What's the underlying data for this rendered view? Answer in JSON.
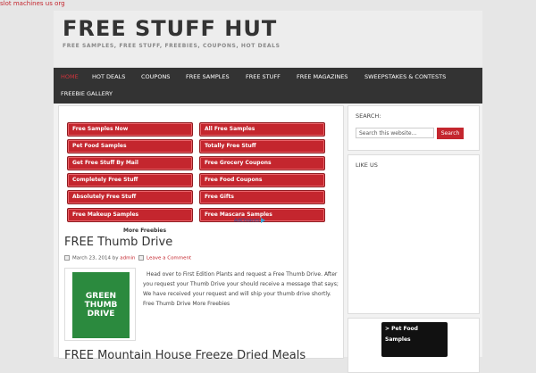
{
  "top_link": "slot machines us org",
  "header": {
    "title": "FREE STUFF HUT",
    "tagline": "FREE SAMPLES, FREE STUFF, FREEBIES, COUPONS, HOT DEALS"
  },
  "nav": {
    "items": [
      "HOME",
      "HOT DEALS",
      "COUPONS",
      "FREE SAMPLES",
      "FREE STUFF",
      "FREE MAGAZINES",
      "SWEEPSTAKES & CONTESTS",
      "FREEBIE GALLERY"
    ]
  },
  "ads": {
    "left": [
      "Free Samples Now",
      "Pet Food Samples",
      "Get Free Stuff By Mail",
      "Completely Free Stuff",
      "Absolutely Free Stuff",
      "Free Makeup Samples"
    ],
    "right": [
      "All Free Samples",
      "Totally Free Stuff",
      "Free Grocery Coupons",
      "Free Food Coupons",
      "Free Gifts",
      "Free Mascara Samples"
    ],
    "adchoices": "AdChoices",
    "more": "More Freebies"
  },
  "post": {
    "title": "FREE Thumb Drive",
    "date": "March 23, 2014",
    "by": "by",
    "author": "admin",
    "comment_link": "Leave a Comment",
    "thumb_lines": [
      "GREEN",
      "THUMB",
      "DRIVE"
    ],
    "excerpt": "Head over to First Edition Plants and request a Free Thumb Drive. After you request your Thumb Drive your should receive a message that says; We have received your request and will ship your thumb drive shortly. Free Thumb Drive More Freebies"
  },
  "post2": {
    "title": "FREE Mountain House Freeze Dried Meals"
  },
  "sidebar": {
    "search_title": "SEARCH:",
    "search_placeholder": "Search this website...",
    "search_button": "Search",
    "like_title": "LIKE US"
  },
  "popup": {
    "text": "> Pet Food Samples"
  },
  "colors": {
    "accent": "#c4262e",
    "nav_bg": "#333333",
    "thumb_green": "#2b8a3e"
  }
}
